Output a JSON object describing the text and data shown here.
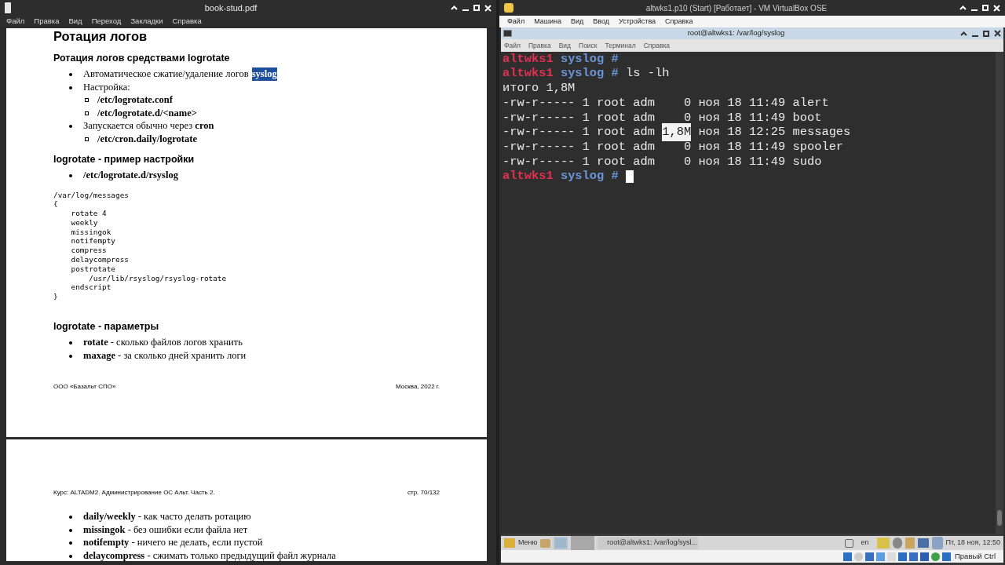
{
  "pdf_viewer": {
    "title": "book-stud.pdf",
    "menu": [
      "Файл",
      "Правка",
      "Вид",
      "Переход",
      "Закладки",
      "Справка"
    ],
    "page_1": {
      "blocks": [
        {
          "kind": "h1",
          "text": "Ротация логов"
        },
        {
          "kind": "h2",
          "text": "Ротация логов средствами logrotate"
        },
        {
          "kind": "list",
          "items": [
            {
              "text": "Автоматическое сжатие/удаление логов",
              "highlight": {
                "text": "syslog",
                "selected": true
              }
            },
            {
              "text": "Настройка:",
              "children": [
                {
                  "text": "/etc/logrotate.conf",
                  "bold": true
                },
                {
                  "text": "/etc/logrotate.d/<name>",
                  "bold": true
                }
              ]
            },
            {
              "text": "Запускается обычно через **cron**",
              "children": [
                {
                  "text": "/etc/cron.daily/logrotate",
                  "bold": true
                }
              ]
            }
          ]
        },
        {
          "kind": "h2",
          "text": "logrotate - пример настройки"
        },
        {
          "kind": "list",
          "items": [
            {
              "text": "/etc/logrotate.d/rsyslog",
              "bold": true
            }
          ]
        },
        {
          "kind": "code",
          "lines": [
            "/var/log/messages",
            "{",
            "    rotate 4",
            "    weekly",
            "    missingok",
            "    notifempty",
            "    compress",
            "    delaycompress",
            "    postrotate",
            "        /usr/lib/rsyslog/rsyslog-rotate",
            "    endscript",
            "}"
          ]
        },
        {
          "kind": "h2",
          "text": "logrotate - параметры"
        },
        {
          "kind": "list",
          "items": [
            {
              "text": "**rotate** - сколько файлов логов хранить"
            },
            {
              "text": "**maxage** - за сколько дней хранить логи"
            }
          ]
        }
      ],
      "footer_left": "ООО «Базальт СПО»",
      "footer_right": "Москва, 2022 г."
    },
    "page_2": {
      "header_left": "Курс: ALTADM2. Администрирование ОС Альт. Часть 2.",
      "header_right": "стр. 70/132",
      "blocks": [
        {
          "kind": "list",
          "items": [
            {
              "text": "**daily/weekly** - как часто делать ротацию"
            },
            {
              "text": "**missingok** - без ошибки если файла нет"
            },
            {
              "text": "**notifempty** - ничего не делать, если пустой"
            },
            {
              "text": "**delaycompress** - сжимать только предыдущий файл журнала"
            }
          ]
        }
      ]
    }
  },
  "vm_window": {
    "title": "altwks1.p10 (Start) [Работает] - VM VirtualBox OSE",
    "menu": [
      "Файл",
      "Машина",
      "Вид",
      "Ввод",
      "Устройства",
      "Справка"
    ],
    "terminal": {
      "title": "root@altwks1: /var/log/syslog",
      "menu": [
        "Файл",
        "Правка",
        "Вид",
        "Поиск",
        "Терминал",
        "Справка"
      ],
      "lines": [
        {
          "kind": "prompt",
          "host": "altwks1",
          "dir": "syslog #",
          "cursor": false
        },
        {
          "kind": "prompt",
          "host": "altwks1",
          "dir": "syslog #",
          "command": "ls -lh",
          "cursor": false
        },
        {
          "kind": "output",
          "text": "итого 1,8M"
        },
        {
          "kind": "file",
          "mode": "-rw-r----- 1 root adm",
          "size": "0",
          "date": "ноя 18 11:49",
          "name": "alert",
          "selected": false
        },
        {
          "kind": "file",
          "mode": "-rw-r----- 1 root adm",
          "size": "0",
          "date": "ноя 18 11:49",
          "name": "boot",
          "selected": false
        },
        {
          "kind": "file",
          "mode": "-rw-r----- 1 root adm",
          "size": "1,8M",
          "date": "ноя 18 12:25",
          "name": "messages",
          "selected": true
        },
        {
          "kind": "file",
          "mode": "-rw-r----- 1 root adm",
          "size": "0",
          "date": "ноя 18 11:49",
          "name": "spooler",
          "selected": false
        },
        {
          "kind": "file",
          "mode": "-rw-r----- 1 root adm",
          "size": "0",
          "date": "ноя 18 11:49",
          "name": "sudo",
          "selected": false
        },
        {
          "kind": "prompt",
          "host": "altwks1",
          "dir": "syslog #",
          "cursor": true
        }
      ]
    },
    "taskbar": {
      "menu_label": "Меню",
      "task": "root@altwks1: /var/log/sysl...",
      "layout": "en",
      "clock": "Пт, 18 ноя, 12:50"
    },
    "status_bar": {
      "host_key": "Правый Ctrl"
    }
  }
}
